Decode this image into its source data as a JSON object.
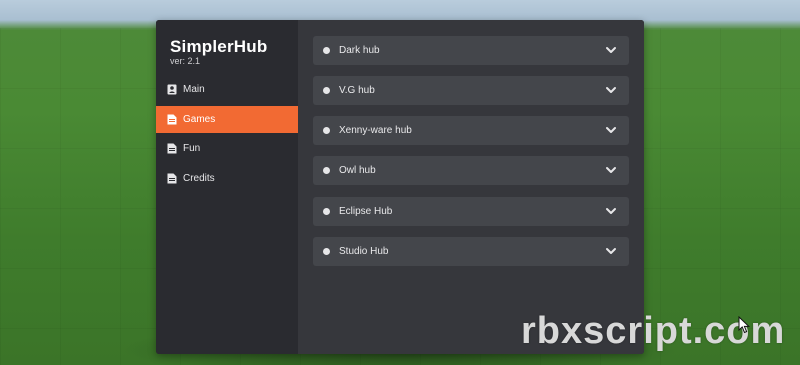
{
  "app": {
    "title": "SimplerHub",
    "version": "ver: 2.1"
  },
  "sidebar": {
    "items": [
      {
        "label": "Main",
        "icon": "person-card-icon",
        "active": false
      },
      {
        "label": "Games",
        "icon": "document-icon",
        "active": true
      },
      {
        "label": "Fun",
        "icon": "document-icon",
        "active": false
      },
      {
        "label": "Credits",
        "icon": "document-icon",
        "active": false
      }
    ]
  },
  "hubs": [
    {
      "label": "Dark hub"
    },
    {
      "label": "V.G hub"
    },
    {
      "label": "Xenny-ware hub"
    },
    {
      "label": "Owl hub"
    },
    {
      "label": "Eclipse Hub"
    },
    {
      "label": "Studio Hub"
    }
  ],
  "watermark": "rbxscript.com",
  "colors": {
    "accent": "#f26a33",
    "panel": "#2b2c31",
    "content": "#36373c",
    "dropdown": "#44464b"
  }
}
